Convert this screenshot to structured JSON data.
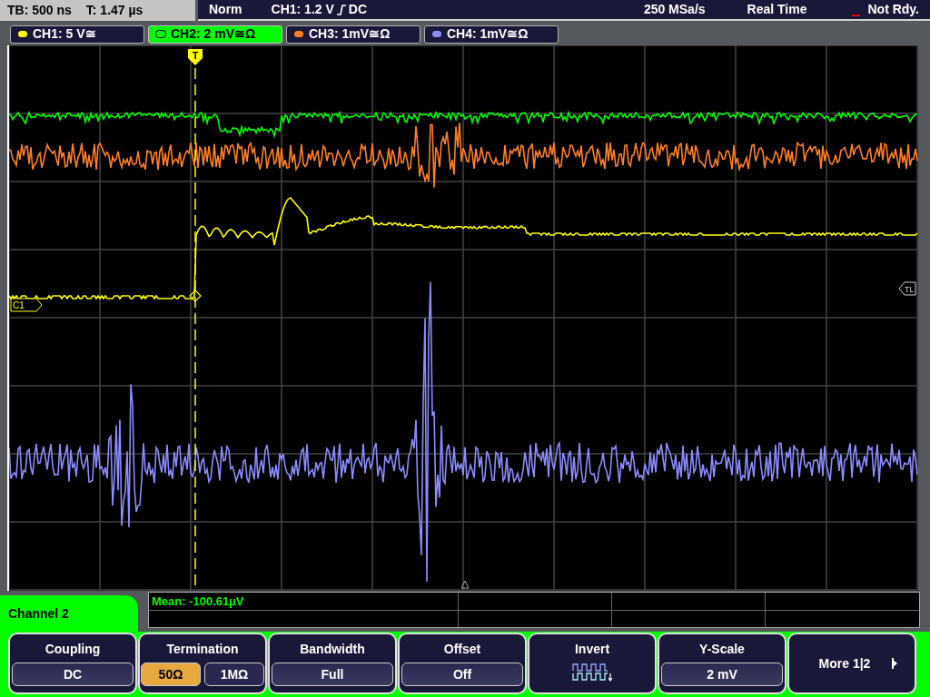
{
  "status_bar": {
    "timebase": "TB: 500 ns",
    "trigger_time": "T: 1.47 µs",
    "mode": "Norm",
    "trigger_source": "CH1: 1.2 V",
    "trigger_coupling": "DC",
    "sample_rate": "250 MSa/s",
    "acquisition": "Real Time",
    "state": "Not Rdy."
  },
  "channels": [
    {
      "label": "CH1: 5 V≅",
      "color": "#ffff00",
      "selected": false
    },
    {
      "label": "CH2: 2 mV≅Ω",
      "color": "#00ff00",
      "selected": true
    },
    {
      "label": "CH3: 1mV≅Ω",
      "color": "#ff7f27",
      "selected": false
    },
    {
      "label": "CH4: 1mV≅Ω",
      "color": "#8c8cff",
      "selected": false
    }
  ],
  "display": {
    "trigger_marker": "T",
    "ground_marker": "C1",
    "level_marker": "TL"
  },
  "measurement": {
    "text": "Mean: -100.61µV"
  },
  "menu": {
    "title": "Channel 2",
    "softkeys": [
      {
        "kind": "value",
        "label": "Coupling",
        "value": "DC"
      },
      {
        "kind": "options",
        "label": "Termination",
        "options": [
          {
            "label": "50Ω",
            "selected": true
          },
          {
            "label": "1MΩ",
            "selected": false
          }
        ]
      },
      {
        "kind": "value",
        "label": "Bandwidth",
        "value": "Full"
      },
      {
        "kind": "value",
        "label": "Offset",
        "value": "Off"
      },
      {
        "kind": "icon",
        "label": "Invert"
      },
      {
        "kind": "value",
        "label": "Y-Scale",
        "value": "2 mV"
      },
      {
        "kind": "next",
        "label": "More 1|2"
      }
    ]
  }
}
